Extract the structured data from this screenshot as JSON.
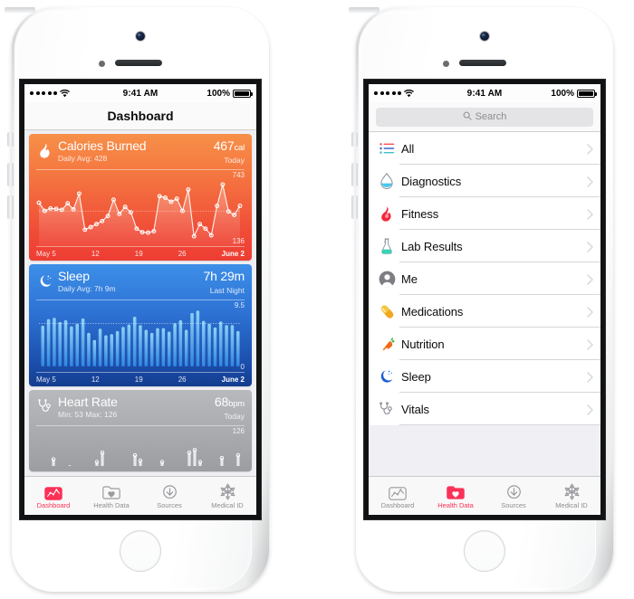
{
  "meta": {
    "accent_red": "#fc3158",
    "bg_grouped": "#efeff4"
  },
  "status_bar": {
    "carrier_dots": 5,
    "wifi_icon": "wifi-icon",
    "time": "9:41 AM",
    "battery_percent": "100%",
    "battery_icon": "battery-full-icon"
  },
  "left_phone": {
    "nav_title": "Dashboard",
    "cards": [
      {
        "id": "calories",
        "icon": "flame-icon",
        "title": "Calories Burned",
        "subtitle": "Daily Avg: 428",
        "value": "467",
        "value_unit": "cal",
        "when": "Today",
        "y_max": "743",
        "y_min": "136",
        "x_labels": [
          "May 5",
          "12",
          "19",
          "26",
          "June 2"
        ]
      },
      {
        "id": "sleep",
        "icon": "moon-icon",
        "title": "Sleep",
        "subtitle": "Daily Avg: 7h 9m",
        "value": "7h 29m",
        "value_unit": "",
        "when": "Last Night",
        "y_max": "9.5",
        "y_min": "0",
        "x_labels": [
          "May 5",
          "12",
          "19",
          "26",
          "June 2"
        ]
      },
      {
        "id": "heart-rate",
        "icon": "stethoscope-icon",
        "title": "Heart Rate",
        "subtitle": "Min: 53 Max: 126",
        "value": "68",
        "value_unit": "bpm",
        "when": "Today",
        "y_max": "126",
        "y_min": "",
        "x_labels": []
      }
    ]
  },
  "right_phone": {
    "search": {
      "placeholder": "Search",
      "value": "",
      "icon": "search-icon"
    },
    "list_items": [
      {
        "label": "All",
        "icon": "list-lines-icon"
      },
      {
        "label": "Diagnostics",
        "icon": "droplet-icon"
      },
      {
        "label": "Fitness",
        "icon": "flame-icon"
      },
      {
        "label": "Lab Results",
        "icon": "flask-icon"
      },
      {
        "label": "Me",
        "icon": "person-icon"
      },
      {
        "label": "Medications",
        "icon": "pill-icon"
      },
      {
        "label": "Nutrition",
        "icon": "carrot-icon"
      },
      {
        "label": "Sleep",
        "icon": "moon-icon"
      },
      {
        "label": "Vitals",
        "icon": "stethoscope-icon"
      }
    ]
  },
  "tabs": [
    {
      "label": "Dashboard",
      "icon": "chart-line-icon",
      "active_left": true,
      "active_right": false
    },
    {
      "label": "Health Data",
      "icon": "folder-heart-icon",
      "active_left": false,
      "active_right": true
    },
    {
      "label": "Sources",
      "icon": "download-icon",
      "active_left": false,
      "active_right": false
    },
    {
      "label": "Medical ID",
      "icon": "asterisk-icon",
      "active_left": false,
      "active_right": false
    }
  ],
  "chart_data": [
    {
      "type": "line",
      "id": "calories-burned",
      "title": "Calories Burned",
      "ylabel": "cal",
      "ylim": [
        136,
        743
      ],
      "xlabel": "",
      "grid": false,
      "legend": "none",
      "avg_line": 428,
      "x_tick_labels": [
        "May 5",
        "12",
        "19",
        "26",
        "June 2"
      ],
      "values": [
        510,
        430,
        455,
        450,
        440,
        505,
        445,
        600,
        245,
        270,
        300,
        330,
        380,
        540,
        400,
        470,
        415,
        255,
        220,
        215,
        230,
        575,
        560,
        520,
        550,
        430,
        640,
        180,
        300,
        255,
        190,
        480,
        690,
        425,
        390,
        480
      ]
    },
    {
      "type": "bar",
      "id": "sleep",
      "title": "Sleep",
      "ylabel": "hours",
      "ylim": [
        0,
        9.5
      ],
      "xlabel": "",
      "grid": false,
      "legend": "none",
      "avg_line": 7.15,
      "x_tick_labels": [
        "May 5",
        "12",
        "19",
        "26",
        "June 2"
      ],
      "values": [
        6.8,
        7.9,
        8.1,
        7.4,
        7.7,
        6.7,
        7.1,
        8.0,
        5.6,
        4.4,
        6.3,
        5.2,
        5.4,
        5.9,
        6.6,
        7.0,
        8.3,
        6.9,
        6.1,
        5.6,
        6.4,
        6.4,
        5.8,
        7.2,
        7.7,
        6.1,
        8.9,
        9.3,
        7.6,
        7.1,
        6.5,
        7.5,
        6.9,
        6.9,
        5.9
      ]
    },
    {
      "type": "scatter",
      "id": "heart-rate",
      "title": "Heart Rate",
      "ylabel": "bpm",
      "ylim": [
        53,
        126
      ],
      "xlabel": "",
      "grid": false,
      "legend": "none",
      "values": [
        60,
        58,
        90,
        62,
        60,
        78,
        68,
        62,
        57,
        56,
        86,
        100,
        74,
        70,
        72,
        66,
        62,
        96,
        88,
        64,
        58,
        56,
        86,
        70,
        58,
        62,
        66,
        100,
        104,
        86,
        72,
        66,
        70,
        92,
        64,
        60,
        96
      ]
    }
  ]
}
